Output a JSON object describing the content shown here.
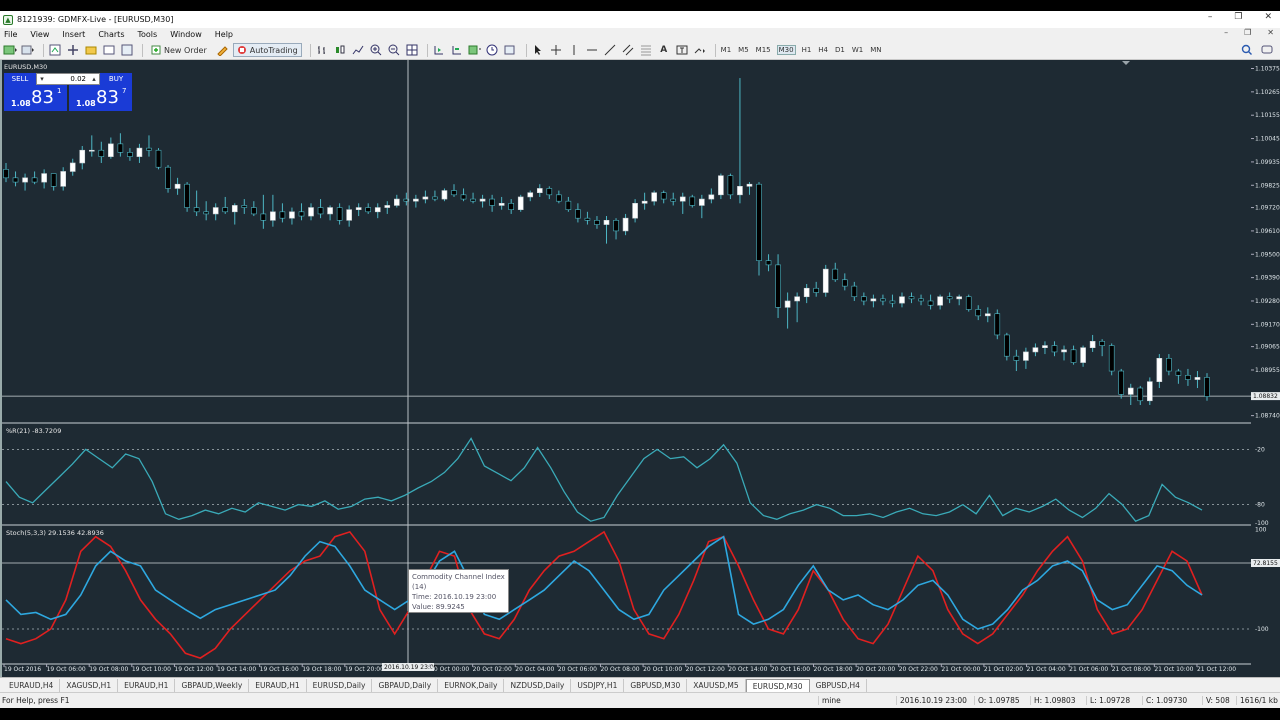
{
  "window": {
    "title": "8121939: GDMFX-Live - [EURUSD,M30]",
    "min": "–",
    "max": "❐",
    "close": "✕"
  },
  "menu": [
    "File",
    "View",
    "Insert",
    "Charts",
    "Tools",
    "Window",
    "Help"
  ],
  "menu_right": {
    "min": "–",
    "restore": "❐",
    "close": "✕"
  },
  "toolbar": {
    "new_order": "New Order",
    "autotrading": "AutoTrading",
    "timeframes": [
      "M1",
      "M5",
      "M15",
      "M30",
      "H1",
      "H4",
      "D1",
      "W1",
      "MN"
    ],
    "active_timeframe": "M30"
  },
  "chart": {
    "symbol_label": "EURUSD,M30",
    "price_levels": [
      "1.10375",
      "1.10265",
      "1.10155",
      "1.10045",
      "1.09935",
      "1.09825",
      "1.09720",
      "1.09610",
      "1.09500",
      "1.09390",
      "1.09280",
      "1.09170",
      "1.09065",
      "1.08955",
      "1.08832",
      "1.08740"
    ],
    "current_price": "1.08832",
    "wr_label": "%R(21) -83.7209",
    "wr_levels": [
      "-20",
      "-80",
      "-100"
    ],
    "stoch_label": "Stoch(5,3,3) 29.1536 42.8936",
    "stoch_levels": [
      "100",
      "72.8155",
      "-100"
    ],
    "time_labels": [
      "19 Oct 2016",
      "19 Oct 06:00",
      "19 Oct 08:00",
      "19 Oct 10:00",
      "19 Oct 12:00",
      "19 Oct 14:00",
      "19 Oct 16:00",
      "19 Oct 18:00",
      "19 Oct 20:00",
      "2016.10.19 23:00",
      "20 Oct 00:00",
      "20 Oct 02:00",
      "20 Oct 04:00",
      "20 Oct 06:00",
      "20 Oct 08:00",
      "20 Oct 10:00",
      "20 Oct 12:00",
      "20 Oct 14:00",
      "20 Oct 16:00",
      "20 Oct 18:00",
      "20 Oct 20:00",
      "20 Oct 22:00",
      "21 Oct 00:00",
      "21 Oct 02:00",
      "21 Oct 04:00",
      "21 Oct 06:00",
      "21 Oct 08:00",
      "21 Oct 10:00",
      "21 Oct 12:00"
    ],
    "bull_color": "#ffffff",
    "bear_color": "#000000",
    "wick_color": "#4db6c4",
    "wr_line_color": "#3aaab8",
    "stoch_main_color": "#2ea8e0",
    "stoch_signal_color": "#e02020"
  },
  "trade_panel": {
    "sell": "SELL",
    "buy": "BUY",
    "lot": "0.02",
    "sell_small": "1.08",
    "sell_big": "83",
    "sell_sup": "1",
    "buy_small": "1.08",
    "buy_big": "83",
    "buy_sup": "7"
  },
  "tooltip": {
    "line1": "Commodity Channel Index",
    "line2": "(14)",
    "line3": "Time: 2016.10.19 23:00",
    "line4": "Value: 89.9245"
  },
  "tabs": [
    "EURAUD,H4",
    "XAGUSD,H1",
    "EURAUD,H1",
    "GBPAUD,Weekly",
    "EURAUD,H1",
    "EURUSD,Daily",
    "GBPAUD,Daily",
    "EURNOK,Daily",
    "NZDUSD,Daily",
    "USDJPY,H1",
    "GBPUSD,M30",
    "XAUUSD,M5",
    "EURUSD,M30",
    "GBPUSD,H4"
  ],
  "active_tab": "EURUSD,M30",
  "status": {
    "help": "For Help, press F1",
    "profile": "mine",
    "datetime": "2016.10.19 23:00",
    "open": "O: 1.09785",
    "high": "H: 1.09803",
    "low": "L: 1.09728",
    "close": "C: 1.09730",
    "volume": "V: 508",
    "traffic": "1616/1 kb"
  },
  "candles": [
    [
      1.099,
      1.0993,
      1.0984,
      1.0986
    ],
    [
      1.0986,
      1.0989,
      1.0982,
      1.0984
    ],
    [
      1.0984,
      1.0988,
      1.098,
      1.0986
    ],
    [
      1.0986,
      1.0989,
      1.0983,
      1.0984
    ],
    [
      1.0984,
      1.099,
      1.0981,
      1.0988
    ],
    [
      1.0988,
      1.0988,
      1.098,
      1.0982
    ],
    [
      1.0982,
      1.0991,
      1.098,
      1.0989
    ],
    [
      1.0989,
      1.0995,
      1.0987,
      1.0993
    ],
    [
      1.0993,
      1.1001,
      1.099,
      1.0999
    ],
    [
      1.0999,
      1.1006,
      1.0996,
      1.0999
    ],
    [
      1.0999,
      1.1003,
      1.0993,
      1.0996
    ],
    [
      1.0996,
      1.1005,
      1.0995,
      1.1002
    ],
    [
      1.1002,
      1.1007,
      1.0996,
      1.0998
    ],
    [
      1.0998,
      1.1,
      1.0994,
      1.0996
    ],
    [
      1.0996,
      1.1002,
      1.0993,
      1.1
    ],
    [
      1.1,
      1.1006,
      1.0996,
      1.0999
    ],
    [
      1.0999,
      1.1,
      1.099,
      1.0991
    ],
    [
      1.0991,
      1.0992,
      1.0979,
      1.0981
    ],
    [
      1.0981,
      1.0986,
      1.0978,
      1.0983
    ],
    [
      1.0983,
      1.0984,
      1.097,
      1.0972
    ],
    [
      1.0972,
      1.098,
      1.0968,
      1.097
    ],
    [
      1.097,
      1.0975,
      1.0966,
      1.0969
    ],
    [
      1.0969,
      1.0974,
      1.0966,
      1.0972
    ],
    [
      1.0972,
      1.0977,
      1.0969,
      1.097
    ],
    [
      1.097,
      1.0974,
      1.0964,
      1.0973
    ],
    [
      1.0973,
      1.0976,
      1.0969,
      1.0972
    ],
    [
      1.0972,
      1.0975,
      1.0968,
      1.0969
    ],
    [
      1.0969,
      1.0978,
      1.0962,
      1.0966
    ],
    [
      1.0966,
      1.0978,
      1.0963,
      1.097
    ],
    [
      1.097,
      1.0974,
      1.0965,
      1.0967
    ],
    [
      1.0967,
      1.0972,
      1.0964,
      1.097
    ],
    [
      1.097,
      1.0974,
      1.0966,
      1.0968
    ],
    [
      1.0968,
      1.0974,
      1.0966,
      1.0972
    ],
    [
      1.0972,
      1.0976,
      1.0967,
      1.0969
    ],
    [
      1.0969,
      1.0973,
      1.0966,
      1.0972
    ],
    [
      1.0972,
      1.0974,
      1.0964,
      1.0966
    ],
    [
      1.0966,
      1.0973,
      1.0963,
      1.0971
    ],
    [
      1.0971,
      1.0974,
      1.0968,
      1.0972
    ],
    [
      1.0972,
      1.0974,
      1.0969,
      1.097
    ],
    [
      1.097,
      1.0974,
      1.0967,
      1.0972
    ],
    [
      1.0972,
      1.0975,
      1.0969,
      1.0973
    ],
    [
      1.0973,
      1.0978,
      1.0972,
      1.0976
    ],
    [
      1.0976,
      1.0979,
      1.0973,
      1.0975
    ],
    [
      1.0975,
      1.0978,
      1.0972,
      1.0976
    ],
    [
      1.0976,
      1.098,
      1.0974,
      1.0977
    ],
    [
      1.0977,
      1.098,
      1.0975,
      1.0976
    ],
    [
      1.0976,
      1.0981,
      1.0975,
      1.098
    ],
    [
      1.098,
      1.0983,
      1.0977,
      1.0978
    ],
    [
      1.0978,
      1.0981,
      1.0975,
      1.0976
    ],
    [
      1.0976,
      1.0979,
      1.0974,
      1.0975
    ],
    [
      1.0975,
      1.0978,
      1.0972,
      1.0976
    ],
    [
      1.0976,
      1.0978,
      1.097,
      1.0973
    ],
    [
      1.0973,
      1.0977,
      1.0971,
      1.0974
    ],
    [
      1.0974,
      1.0976,
      1.0969,
      1.0971
    ],
    [
      1.0971,
      1.0978,
      1.097,
      1.0977
    ],
    [
      1.0977,
      1.098,
      1.0975,
      1.0979
    ],
    [
      1.0979,
      1.0983,
      1.0977,
      1.0981
    ],
    [
      1.0981,
      1.0982,
      1.0976,
      1.0978
    ],
    [
      1.0978,
      1.098,
      1.0974,
      1.0975
    ],
    [
      1.0975,
      1.0977,
      1.097,
      1.0971
    ],
    [
      1.0971,
      1.0974,
      1.0965,
      1.0967
    ],
    [
      1.0967,
      1.097,
      1.0964,
      1.0966
    ],
    [
      1.0966,
      1.0968,
      1.0962,
      1.0964
    ],
    [
      1.0964,
      1.0968,
      1.0955,
      1.0966
    ],
    [
      1.0966,
      1.0967,
      1.0957,
      1.0961
    ],
    [
      1.0961,
      1.0969,
      1.0959,
      1.0967
    ],
    [
      1.0967,
      1.0976,
      1.0965,
      1.0974
    ],
    [
      1.0974,
      1.0979,
      1.0971,
      1.0975
    ],
    [
      1.0975,
      1.098,
      1.0973,
      1.0979
    ],
    [
      1.0979,
      1.098,
      1.0974,
      1.0976
    ],
    [
      1.0976,
      1.0979,
      1.0973,
      1.0975
    ],
    [
      1.0975,
      1.0979,
      1.0969,
      1.0977
    ],
    [
      1.0977,
      1.0978,
      1.0972,
      1.0973
    ],
    [
      1.0973,
      1.0978,
      1.0967,
      1.0976
    ],
    [
      1.0976,
      1.0981,
      1.0974,
      1.0978
    ],
    [
      1.0978,
      1.0988,
      1.0976,
      1.0987
    ],
    [
      1.0987,
      1.0988,
      1.0976,
      1.0978
    ],
    [
      1.0978,
      1.1033,
      1.0974,
      1.0982
    ],
    [
      1.0982,
      1.0984,
      1.0978,
      1.0983
    ],
    [
      1.0983,
      1.0984,
      1.094,
      1.0947
    ],
    [
      1.0947,
      1.095,
      1.0942,
      1.0945
    ],
    [
      1.0945,
      1.095,
      1.092,
      1.0925
    ],
    [
      1.0925,
      1.0932,
      1.0915,
      1.0928
    ],
    [
      1.0928,
      1.0932,
      1.0918,
      1.093
    ],
    [
      1.093,
      1.0936,
      1.0927,
      1.0934
    ],
    [
      1.0934,
      1.0937,
      1.093,
      1.0932
    ],
    [
      1.0932,
      1.0945,
      1.093,
      1.0943
    ],
    [
      1.0943,
      1.0946,
      1.0937,
      1.0938
    ],
    [
      1.0938,
      1.0941,
      1.0933,
      1.0935
    ],
    [
      1.0935,
      1.0937,
      1.0928,
      1.093
    ],
    [
      1.093,
      1.0932,
      1.0926,
      1.0928
    ],
    [
      1.0928,
      1.0931,
      1.0925,
      1.0929
    ],
    [
      1.0929,
      1.0931,
      1.0926,
      1.0928
    ],
    [
      1.0928,
      1.0931,
      1.0925,
      1.0927
    ],
    [
      1.0927,
      1.0932,
      1.0925,
      1.093
    ],
    [
      1.093,
      1.0932,
      1.0927,
      1.0929
    ],
    [
      1.0929,
      1.0931,
      1.0926,
      1.0928
    ],
    [
      1.0928,
      1.0931,
      1.0924,
      1.0926
    ],
    [
      1.0926,
      1.0931,
      1.0924,
      1.093
    ],
    [
      1.093,
      1.0932,
      1.0927,
      1.0929
    ],
    [
      1.0929,
      1.0931,
      1.0926,
      1.093
    ],
    [
      1.093,
      1.0931,
      1.0923,
      1.0924
    ],
    [
      1.0924,
      1.0926,
      1.0919,
      1.0921
    ],
    [
      1.0921,
      1.0925,
      1.0918,
      1.0922
    ],
    [
      1.0922,
      1.0924,
      1.091,
      1.0912
    ],
    [
      1.0912,
      1.0913,
      1.09,
      1.0902
    ],
    [
      1.0902,
      1.0905,
      1.0895,
      1.09
    ],
    [
      1.09,
      1.0906,
      1.0896,
      1.0904
    ],
    [
      1.0904,
      1.0908,
      1.0902,
      1.0906
    ],
    [
      1.0906,
      1.0909,
      1.0903,
      1.0907
    ],
    [
      1.0907,
      1.0909,
      1.0902,
      1.0904
    ],
    [
      1.0904,
      1.0907,
      1.09,
      1.0905
    ],
    [
      1.0905,
      1.0907,
      1.0898,
      1.0899
    ],
    [
      1.0899,
      1.0907,
      1.0897,
      1.0906
    ],
    [
      1.0906,
      1.0912,
      1.0904,
      1.0909
    ],
    [
      1.0909,
      1.091,
      1.0902,
      1.0907
    ],
    [
      1.0907,
      1.0908,
      1.0893,
      1.0895
    ],
    [
      1.0895,
      1.0896,
      1.0882,
      1.0884
    ],
    [
      1.0884,
      1.0889,
      1.0879,
      1.0887
    ],
    [
      1.0887,
      1.0888,
      1.0879,
      1.0881
    ],
    [
      1.0881,
      1.0892,
      1.0879,
      1.089
    ],
    [
      1.089,
      1.0903,
      1.0887,
      1.0901
    ],
    [
      1.0901,
      1.0903,
      1.0893,
      1.0895
    ],
    [
      1.0895,
      1.0896,
      1.0889,
      1.0893
    ],
    [
      1.0893,
      1.0896,
      1.0888,
      1.0891
    ],
    [
      1.0891,
      1.0895,
      1.0887,
      1.0892
    ],
    [
      1.0892,
      1.0894,
      1.0881,
      1.0883
    ]
  ],
  "wr_values": [
    -55,
    -72,
    -78,
    -64,
    -50,
    -36,
    -20,
    -30,
    -40,
    -25,
    -30,
    -55,
    -90,
    -96,
    -92,
    -86,
    -90,
    -84,
    -88,
    -78,
    -82,
    -86,
    -80,
    -82,
    -76,
    -85,
    -82,
    -74,
    -72,
    -76,
    -70,
    -62,
    -55,
    -45,
    -30,
    -8,
    -38,
    -46,
    -54,
    -40,
    -18,
    -40,
    -66,
    -88,
    -98,
    -94,
    -70,
    -50,
    -30,
    -20,
    -30,
    -28,
    -40,
    -30,
    -15,
    -35,
    -78,
    -92,
    -96,
    -90,
    -86,
    -80,
    -84,
    -92,
    -92,
    -90,
    -94,
    -88,
    -84,
    -90,
    -92,
    -88,
    -80,
    -90,
    -70,
    -92,
    -84,
    -88,
    -82,
    -74,
    -86,
    -94,
    -84,
    -68,
    -80,
    -98,
    -92,
    -58,
    -72,
    -78,
    -86
  ],
  "stoch_main": [
    -40,
    -70,
    -66,
    -80,
    -70,
    -30,
    30,
    60,
    40,
    30,
    -20,
    -40,
    -60,
    -78,
    -60,
    -50,
    -40,
    -30,
    -20,
    10,
    50,
    80,
    70,
    30,
    -20,
    -40,
    -60,
    -40,
    -10,
    40,
    60,
    0,
    -70,
    -80,
    -60,
    -40,
    -20,
    10,
    40,
    20,
    -20,
    -60,
    -80,
    -70,
    -20,
    10,
    40,
    70,
    90,
    -70,
    -90,
    -80,
    -60,
    -10,
    30,
    -20,
    -40,
    -30,
    -50,
    -60,
    -40,
    -10,
    0,
    -30,
    -80,
    -100,
    -90,
    -60,
    -20,
    0,
    30,
    40,
    20,
    -40,
    -60,
    -50,
    -10,
    30,
    20,
    -10,
    -30
  ],
  "stoch_signal": [
    -120,
    -130,
    -120,
    -100,
    -40,
    60,
    90,
    70,
    20,
    -40,
    -80,
    -110,
    -150,
    -160,
    -140,
    -100,
    -70,
    -40,
    -10,
    20,
    40,
    50,
    90,
    100,
    60,
    -60,
    -110,
    -60,
    0,
    60,
    50,
    -60,
    -110,
    -120,
    -80,
    -20,
    20,
    50,
    60,
    80,
    100,
    40,
    -60,
    -110,
    -120,
    -70,
    0,
    80,
    90,
    30,
    -40,
    -100,
    -110,
    -60,
    20,
    -20,
    -80,
    -120,
    -130,
    -90,
    -20,
    50,
    20,
    -60,
    -110,
    -130,
    -110,
    -70,
    -30,
    20,
    60,
    90,
    40,
    -60,
    -110,
    -100,
    -60,
    0,
    60,
    40,
    -30
  ]
}
